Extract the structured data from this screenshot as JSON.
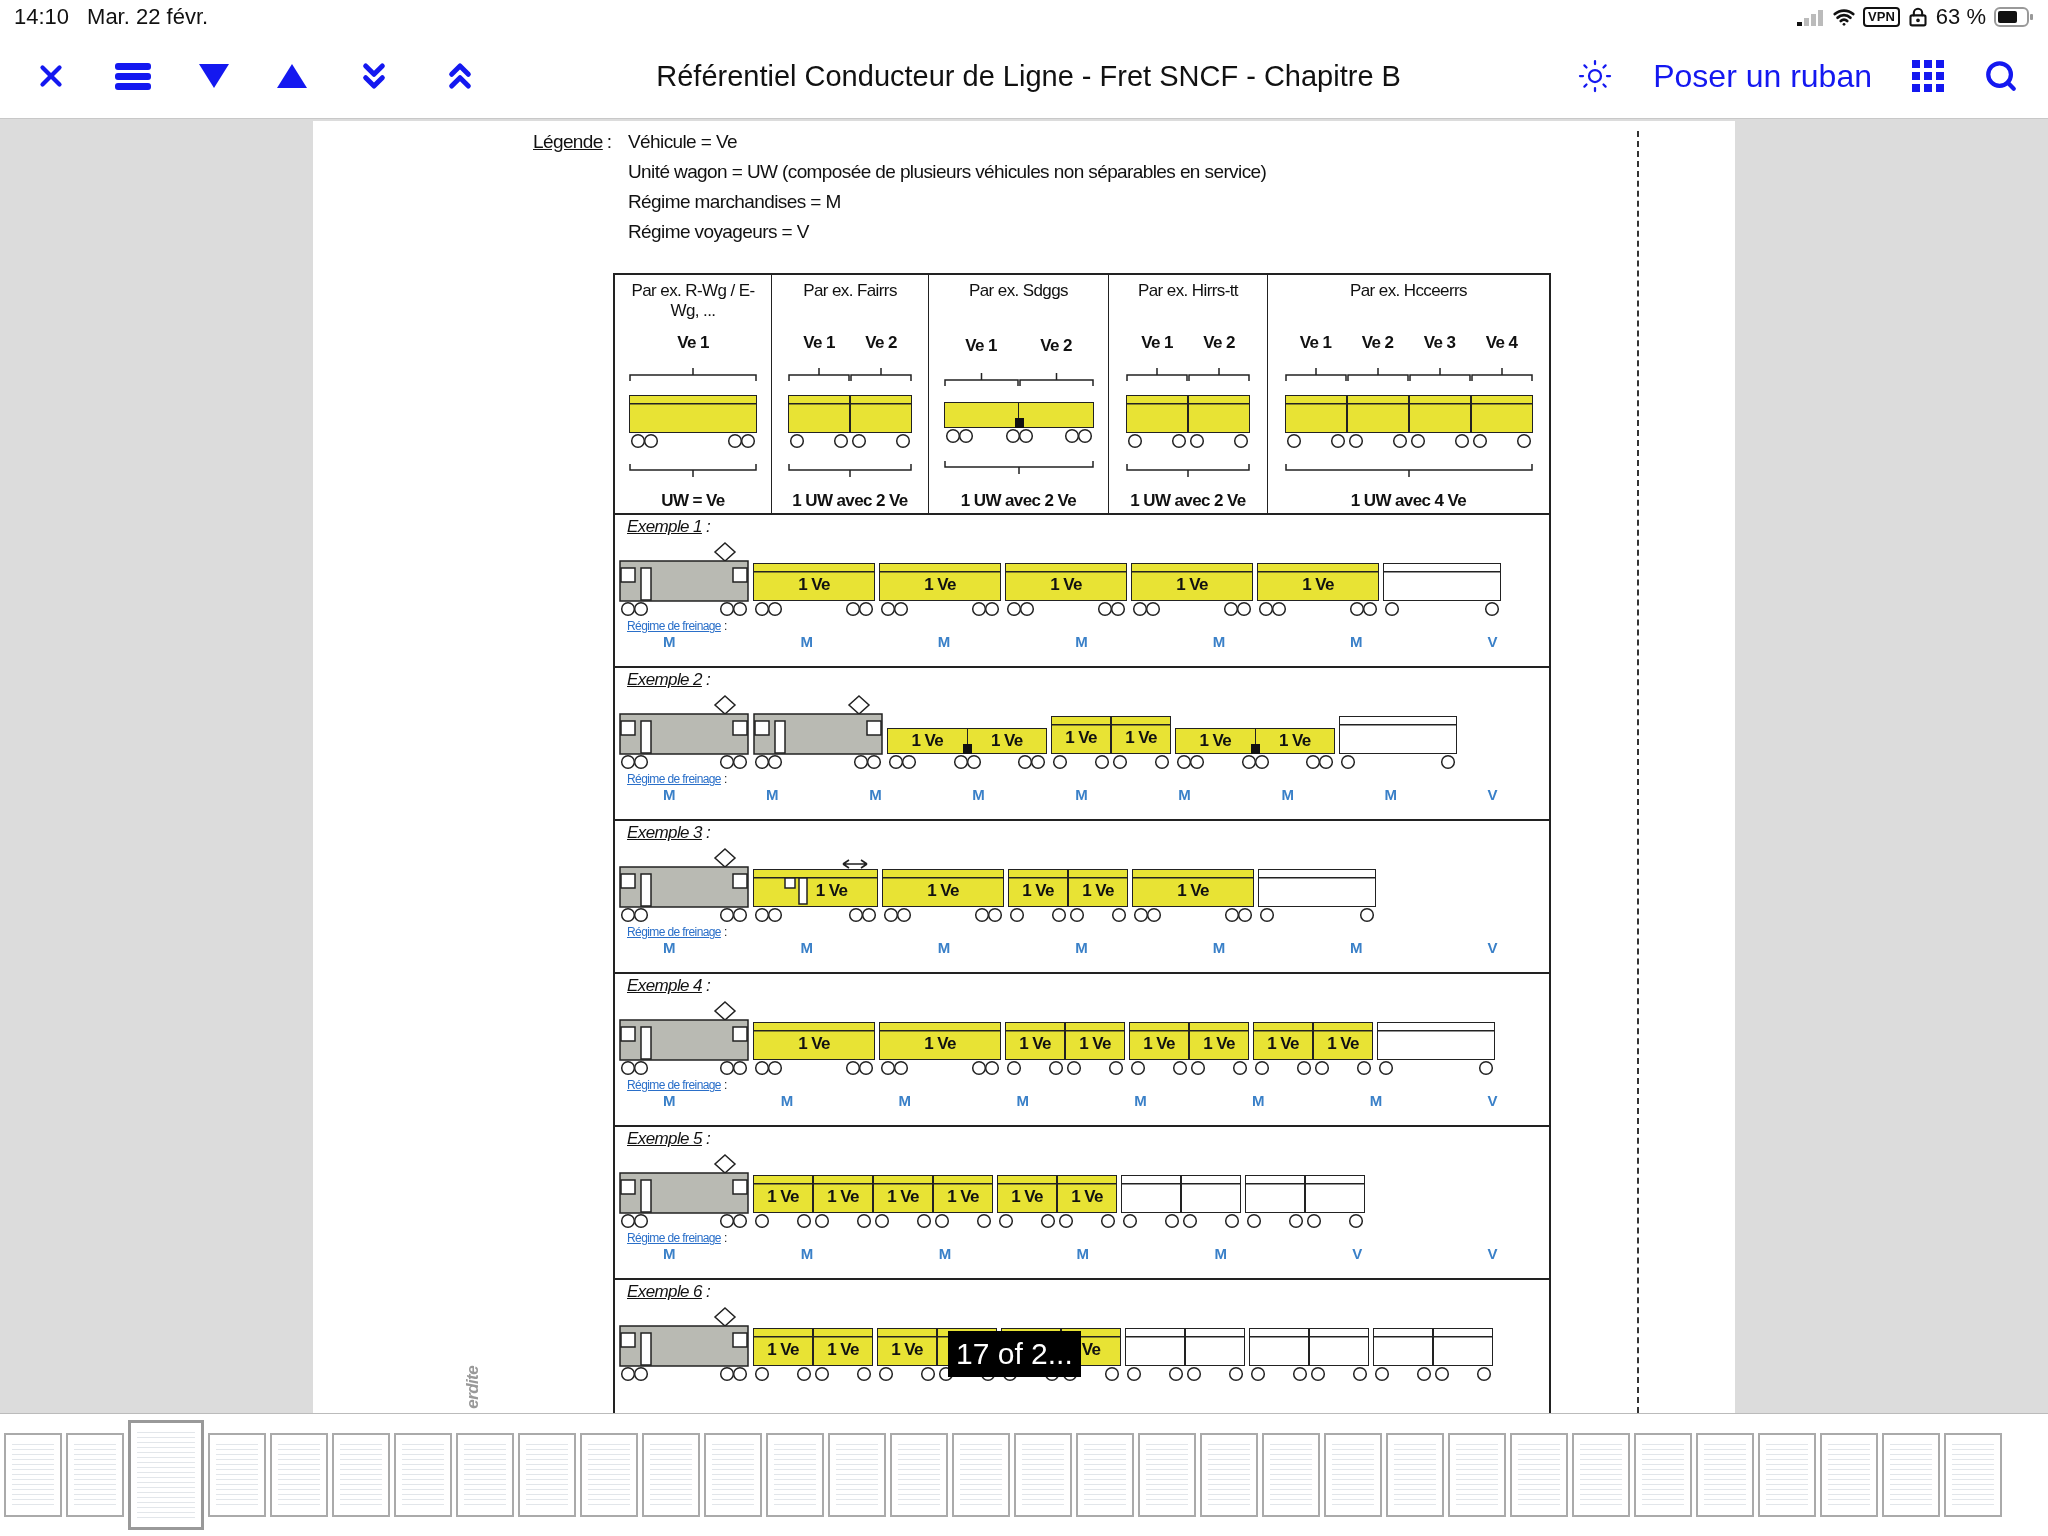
{
  "status_bar": {
    "time": "14:10",
    "date": "Mar. 22 févr.",
    "vpn": "VPN",
    "battery": "63 %"
  },
  "toolbar": {
    "title": "Référentiel Conducteur de Ligne - Fret SNCF - Chapitre B",
    "ribbon_button": "Poser un ruban"
  },
  "document": {
    "legend": {
      "label": "Légende",
      "separator": ":",
      "lines": [
        "Véhicule = Ve",
        "Unité wagon = UW (composée de plusieurs véhicules non séparables en service)",
        "Régime marchandises = M",
        "Régime voyageurs = V"
      ]
    },
    "types": [
      {
        "caption": "Par ex. R-Wg / E-Wg, ...",
        "kind": "wagon",
        "vehicles": [
          "Ve 1"
        ],
        "footer": "UW = Ve"
      },
      {
        "caption": "Par ex. Fairrs",
        "kind": "wagon",
        "vehicles": [
          "Ve 1",
          "Ve 2"
        ],
        "footer": "1 UW avec 2 Ve"
      },
      {
        "caption": "Par ex. Sdggs",
        "kind": "flat",
        "vehicles": [
          "Ve 1",
          "Ve 2"
        ],
        "footer": "1 UW avec 2 Ve"
      },
      {
        "caption": "Par ex. Hirrs-tt",
        "kind": "wagon",
        "vehicles": [
          "Ve 1",
          "Ve 2"
        ],
        "footer": "1 UW avec 2 Ve"
      },
      {
        "caption": "Par ex. Hcceerrs",
        "kind": "wagon",
        "vehicles": [
          "Ve 1",
          "Ve 2",
          "Ve 3",
          "Ve 4"
        ],
        "footer": "1 UW avec 4 Ve"
      }
    ],
    "examples": [
      {
        "title": "Exemple 1",
        "separator": ":",
        "brake_label": "Régime de freinage",
        "brake_separator": ":",
        "cars": [
          {
            "kind": "loco"
          },
          {
            "kind": "wagon",
            "sections": [
              {
                "loaded": true,
                "label": "1 Ve"
              }
            ]
          },
          {
            "kind": "wagon",
            "sections": [
              {
                "loaded": true,
                "label": "1 Ve"
              }
            ]
          },
          {
            "kind": "wagon",
            "sections": [
              {
                "loaded": true,
                "label": "1 Ve"
              }
            ]
          },
          {
            "kind": "wagon",
            "sections": [
              {
                "loaded": true,
                "label": "1 Ve"
              }
            ]
          },
          {
            "kind": "wagon",
            "sections": [
              {
                "loaded": true,
                "label": "1 Ve"
              }
            ]
          },
          {
            "kind": "empty",
            "sections": [
              {
                "loaded": false
              }
            ]
          }
        ],
        "regimes": [
          "M",
          "M",
          "M",
          "M",
          "M",
          "M",
          "V"
        ]
      },
      {
        "title": "Exemple 2",
        "separator": ":",
        "brake_label": "Régime de freinage",
        "brake_separator": ":",
        "cars": [
          {
            "kind": "loco"
          },
          {
            "kind": "loco"
          },
          {
            "kind": "flat",
            "sections": [
              {
                "loaded": true,
                "label": "1 Ve"
              },
              {
                "loaded": true,
                "label": "1 Ve"
              }
            ]
          },
          {
            "kind": "wagon",
            "sections": [
              {
                "loaded": true,
                "label": "1 Ve"
              },
              {
                "loaded": true,
                "label": "1 Ve"
              }
            ]
          },
          {
            "kind": "flat",
            "sections": [
              {
                "loaded": true,
                "label": "1 Ve"
              },
              {
                "loaded": true,
                "label": "1 Ve"
              }
            ]
          },
          {
            "kind": "empty",
            "sections": [
              {
                "loaded": false
              }
            ]
          }
        ],
        "regimes": [
          "M",
          "M",
          "M",
          "M",
          "M",
          "M",
          "M",
          "M",
          "V"
        ]
      },
      {
        "title": "Exemple 3",
        "separator": ":",
        "brake_label": "Régime de freinage",
        "brake_separator": ":",
        "cars": [
          {
            "kind": "loco"
          },
          {
            "kind": "cab",
            "sections": [
              {
                "loaded": true,
                "label": "1 Ve"
              }
            ]
          },
          {
            "kind": "wagon",
            "sections": [
              {
                "loaded": true,
                "label": "1 Ve"
              }
            ]
          },
          {
            "kind": "wagon",
            "sections": [
              {
                "loaded": true,
                "label": "1 Ve"
              },
              {
                "loaded": true,
                "label": "1 Ve"
              }
            ]
          },
          {
            "kind": "wagon",
            "sections": [
              {
                "loaded": true,
                "label": "1 Ve"
              }
            ]
          },
          {
            "kind": "empty",
            "sections": [
              {
                "loaded": false
              }
            ]
          }
        ],
        "regimes": [
          "M",
          "M",
          "M",
          "M",
          "M",
          "M",
          "V"
        ]
      },
      {
        "title": "Exemple 4",
        "separator": ":",
        "brake_label": "Régime de freinage",
        "brake_separator": ":",
        "cars": [
          {
            "kind": "loco"
          },
          {
            "kind": "wagon",
            "sections": [
              {
                "loaded": true,
                "label": "1 Ve"
              }
            ]
          },
          {
            "kind": "wagon",
            "sections": [
              {
                "loaded": true,
                "label": "1 Ve"
              }
            ]
          },
          {
            "kind": "wagon",
            "sections": [
              {
                "loaded": true,
                "label": "1 Ve"
              },
              {
                "loaded": true,
                "label": "1 Ve"
              }
            ]
          },
          {
            "kind": "wagon",
            "sections": [
              {
                "loaded": true,
                "label": "1 Ve"
              },
              {
                "loaded": true,
                "label": "1 Ve"
              }
            ]
          },
          {
            "kind": "wagon",
            "sections": [
              {
                "loaded": true,
                "label": "1 Ve"
              },
              {
                "loaded": true,
                "label": "1 Ve"
              }
            ]
          },
          {
            "kind": "empty",
            "sections": [
              {
                "loaded": false
              }
            ]
          }
        ],
        "regimes": [
          "M",
          "M",
          "M",
          "M",
          "M",
          "M",
          "M",
          "V"
        ]
      },
      {
        "title": "Exemple 5",
        "separator": ":",
        "brake_label": "Régime de freinage",
        "brake_separator": ":",
        "cars": [
          {
            "kind": "loco"
          },
          {
            "kind": "wagon",
            "sections": [
              {
                "loaded": true,
                "label": "1 Ve"
              },
              {
                "loaded": true,
                "label": "1 Ve"
              },
              {
                "loaded": true,
                "label": "1 Ve"
              },
              {
                "loaded": true,
                "label": "1 Ve"
              }
            ]
          },
          {
            "kind": "wagon",
            "sections": [
              {
                "loaded": true,
                "label": "1 Ve"
              },
              {
                "loaded": true,
                "label": "1 Ve"
              }
            ]
          },
          {
            "kind": "empty",
            "sections": [
              {
                "loaded": false
              },
              {
                "loaded": false
              }
            ]
          },
          {
            "kind": "empty",
            "sections": [
              {
                "loaded": false
              },
              {
                "loaded": false
              }
            ]
          }
        ],
        "regimes": [
          "M",
          "M",
          "M",
          "M",
          "M",
          "V",
          "V"
        ]
      },
      {
        "title": "Exemple 6",
        "separator": ":",
        "cars": [
          {
            "kind": "loco"
          },
          {
            "kind": "wagon",
            "sections": [
              {
                "loaded": true,
                "label": "1 Ve"
              },
              {
                "loaded": true,
                "label": "1 Ve"
              }
            ]
          },
          {
            "kind": "wagon",
            "sections": [
              {
                "loaded": true,
                "label": "1 Ve"
              },
              {
                "loaded": true
              }
            ]
          },
          {
            "kind": "wagon",
            "sections": [
              {
                "loaded": true
              },
              {
                "loaded": true,
                "label": "Ve"
              }
            ]
          },
          {
            "kind": "empty",
            "sections": [
              {
                "loaded": false
              },
              {
                "loaded": false
              }
            ]
          },
          {
            "kind": "empty",
            "sections": [
              {
                "loaded": false
              },
              {
                "loaded": false
              }
            ]
          },
          {
            "kind": "empty",
            "sections": [
              {
                "loaded": false
              },
              {
                "loaded": false
              }
            ]
          }
        ]
      }
    ],
    "margin_note": "erdite"
  },
  "page_indicator": "17 of 2...",
  "thumbnails": [
    {
      "selected": false
    },
    {
      "selected": false
    },
    {
      "selected": true
    },
    {
      "selected": false
    },
    {
      "selected": false
    },
    {
      "selected": false
    },
    {
      "selected": false
    },
    {
      "selected": false
    },
    {
      "selected": false
    },
    {
      "selected": false
    },
    {
      "selected": false
    },
    {
      "selected": false
    },
    {
      "selected": false
    },
    {
      "selected": false
    },
    {
      "selected": false
    },
    {
      "selected": false
    },
    {
      "selected": false
    },
    {
      "selected": false
    },
    {
      "selected": false
    },
    {
      "selected": false
    },
    {
      "selected": false
    },
    {
      "selected": false
    },
    {
      "selected": false
    },
    {
      "selected": false
    },
    {
      "selected": false
    },
    {
      "selected": false
    },
    {
      "selected": false
    },
    {
      "selected": false
    },
    {
      "selected": false
    },
    {
      "selected": false
    },
    {
      "selected": false
    },
    {
      "selected": false
    }
  ]
}
